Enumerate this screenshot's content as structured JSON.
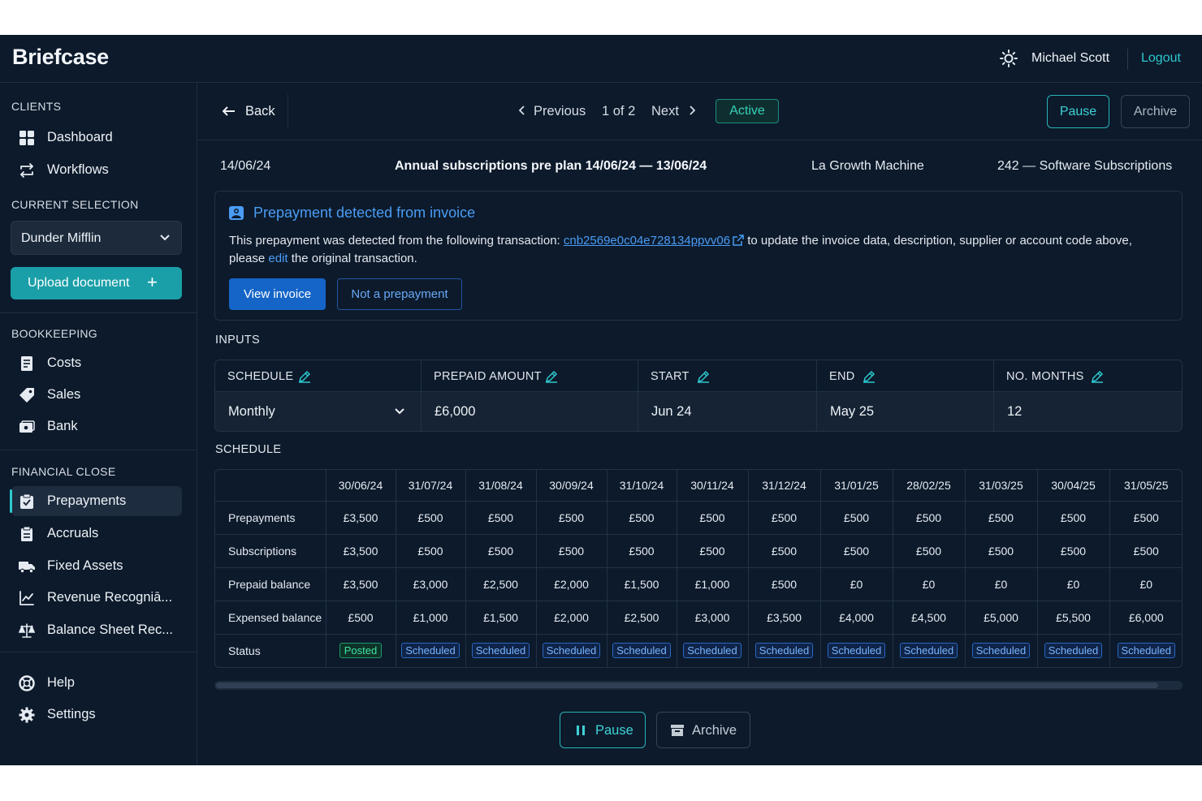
{
  "app": {
    "title": "Briefcase"
  },
  "header": {
    "user_name": "Michael Scott",
    "logout_label": "Logout",
    "theme_icon": "sun-icon"
  },
  "sidebar": {
    "clients_title": "CLIENTS",
    "clients_items": [
      {
        "label": "Dashboard",
        "icon": "dashboard-icon"
      },
      {
        "label": "Workflows",
        "icon": "workflows-icon"
      }
    ],
    "current_selection_title": "CURRENT SELECTION",
    "client_select_value": "Dunder Mifflin",
    "upload_label": "Upload document",
    "bookkeeping_title": "BOOKKEEPING",
    "bookkeeping_items": [
      {
        "label": "Costs",
        "icon": "costs-icon"
      },
      {
        "label": "Sales",
        "icon": "tag-icon"
      },
      {
        "label": "Bank",
        "icon": "bank-icon"
      }
    ],
    "financial_close_title": "FINANCIAL CLOSE",
    "financial_close_items": [
      {
        "label": "Prepayments",
        "icon": "prepayments-icon",
        "active": true
      },
      {
        "label": "Accruals",
        "icon": "accruals-icon"
      },
      {
        "label": "Fixed Assets",
        "icon": "truck-icon"
      },
      {
        "label": "Revenue Recogniā...",
        "icon": "chart-line-icon"
      },
      {
        "label": "Balance Sheet Rec...",
        "icon": "scales-icon"
      }
    ],
    "bottom_items": [
      {
        "label": "Help",
        "icon": "help-icon"
      },
      {
        "label": "Settings",
        "icon": "gear-icon"
      }
    ]
  },
  "toolbar": {
    "back_label": "Back",
    "previous_label": "Previous",
    "page_indicator": "1 of 2",
    "next_label": "Next",
    "status_badge": "Active",
    "pause_label": "Pause",
    "archive_label": "Archive"
  },
  "meta": {
    "date": "14/06/24",
    "title": "Annual subscriptions pre plan 14/06/24 — 13/06/24",
    "supplier": "La Growth Machine",
    "account": "242 — Software Subscriptions"
  },
  "notice": {
    "title": "Prepayment detected from invoice",
    "text_before": "This prepayment was detected from the following transaction: ",
    "transaction_link": "cnb2569e0c04e728134ppvv06",
    "text_middle": " to update the invoice data, description, supplier or account code above, please ",
    "edit_link": "edit",
    "text_after": " the original transaction.",
    "view_invoice_label": "View invoice",
    "not_prepayment_label": "Not a prepayment"
  },
  "inputs": {
    "section_label": "INPUTS",
    "fields": [
      {
        "label": "SCHEDULE",
        "value": "Monthly"
      },
      {
        "label": "PREPAID AMOUNT",
        "value": "£6,000"
      },
      {
        "label": "START",
        "value": "Jun 24"
      },
      {
        "label": "END",
        "value": "May 25"
      },
      {
        "label": "NO. MONTHS",
        "value": "12"
      }
    ]
  },
  "schedule": {
    "section_label": "SCHEDULE",
    "columns": [
      "30/06/24",
      "31/07/24",
      "31/08/24",
      "30/09/24",
      "31/10/24",
      "30/11/24",
      "31/12/24",
      "31/01/25",
      "28/02/25",
      "31/03/25",
      "30/04/25",
      "31/05/25"
    ],
    "rows": [
      {
        "label": "Prepayments",
        "values": [
          "£3,500",
          "£500",
          "£500",
          "£500",
          "£500",
          "£500",
          "£500",
          "£500",
          "£500",
          "£500",
          "£500",
          "£500"
        ]
      },
      {
        "label": "Subscriptions",
        "values": [
          "£3,500",
          "£500",
          "£500",
          "£500",
          "£500",
          "£500",
          "£500",
          "£500",
          "£500",
          "£500",
          "£500",
          "£500"
        ]
      },
      {
        "label": "Prepaid balance",
        "values": [
          "£3,500",
          "£3,000",
          "£2,500",
          "£2,000",
          "£1,500",
          "£1,000",
          "£500",
          "£0",
          "£0",
          "£0",
          "£0",
          "£0"
        ]
      },
      {
        "label": "Expensed balance",
        "values": [
          "£500",
          "£1,000",
          "£1,500",
          "£2,000",
          "£2,500",
          "£3,000",
          "£3,500",
          "£4,000",
          "£4,500",
          "£5,000",
          "£5,500",
          "£6,000"
        ]
      }
    ],
    "status_label": "Status",
    "statuses": [
      "Posted",
      "Scheduled",
      "Scheduled",
      "Scheduled",
      "Scheduled",
      "Scheduled",
      "Scheduled",
      "Scheduled",
      "Scheduled",
      "Scheduled",
      "Scheduled",
      "Scheduled"
    ]
  },
  "footer_actions": {
    "pause_label": "Pause",
    "archive_label": "Archive"
  },
  "colors": {
    "background": "#0c1a2b",
    "accent": "#2ec8cf",
    "link": "#4a9cf5",
    "primary_button": "#1565c8"
  }
}
